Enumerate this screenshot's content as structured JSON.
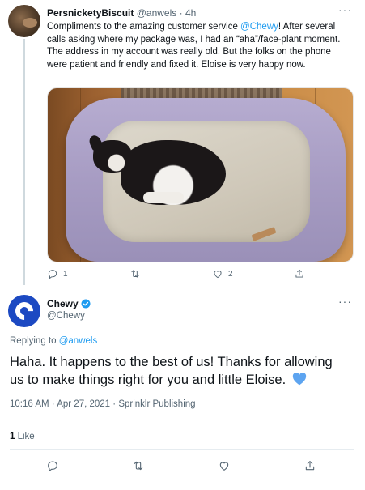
{
  "reply_tweet": {
    "author_name": "PersnicketyBiscuit",
    "author_handle": "@anwels",
    "time": "4h",
    "text_part1": "Compliments to the amazing customer service ",
    "mention": "@Chewy",
    "text_part2": "! After several calls asking where my package was, I had an “aha”/face-plant moment. The address in my account was really old. But the folks on the phone were patient and friendly and fixed it. Eloise is very happy now.",
    "reply_count": "1",
    "retweet_count": "",
    "like_count": "2",
    "menu_label": "···",
    "icons": {
      "reply": "reply-icon",
      "retweet": "retweet-icon",
      "like": "heart-icon",
      "share": "share-icon"
    }
  },
  "main_tweet": {
    "author_name": "Chewy",
    "author_handle": "@Chewy",
    "verified": true,
    "menu_label": "···",
    "replying_prefix": "Replying to ",
    "replying_handle": "@anwels",
    "text": "Haha. It happens to the best of us! Thanks for allowing us to make things right for you and little Eloise.",
    "emoji": "blue-heart-icon",
    "time": "10:16 AM",
    "date": "Apr 27, 2021",
    "separator": "·",
    "source": "Sprinklr Publishing",
    "likes_count": "1",
    "likes_label": "Like",
    "icons": {
      "reply": "reply-icon",
      "retweet": "retweet-icon",
      "like": "heart-icon",
      "share": "share-icon"
    }
  },
  "colors": {
    "link": "#1d9bf0",
    "muted_text": "#536471",
    "chewy_brand": "#1c49c2",
    "verified_badge": "#1d9bf0",
    "heart_emoji": "#5da4f0"
  }
}
